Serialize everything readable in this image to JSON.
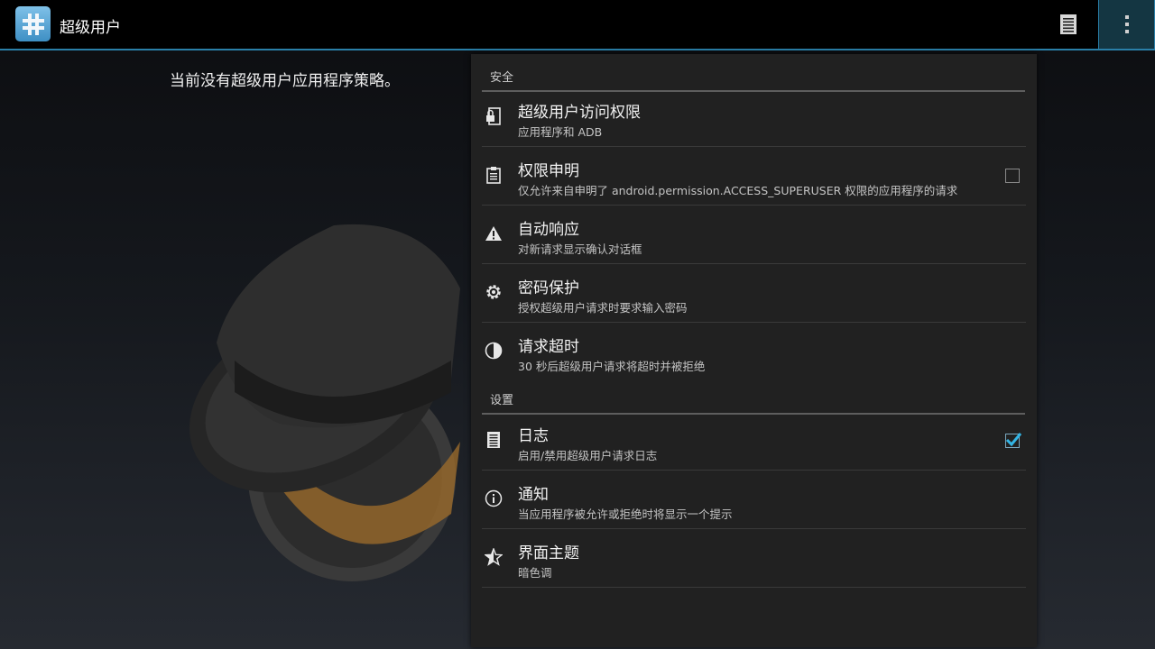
{
  "action_bar": {
    "title": "超级用户",
    "app_icon": "hash-app-icon",
    "log_icon": "log-list-icon",
    "overflow_icon": "overflow-menu-icon",
    "accent_color": "#2a7fa8"
  },
  "main": {
    "empty_message": "当前没有超级用户应用程序策略。"
  },
  "settings": {
    "security_header": "安全",
    "settings_header": "设置",
    "items": [
      {
        "title": "超级用户访问权限",
        "summary": "应用程序和 ADB",
        "icon": "lock-device-icon"
      },
      {
        "title": "权限申明",
        "summary": "仅允许来自申明了 android.permission.ACCESS_SUPERUSER 权限的应用程序的请求",
        "icon": "clipboard-icon",
        "checked": false
      },
      {
        "title": "自动响应",
        "summary": "对新请求显示确认对话框",
        "icon": "warning-icon"
      },
      {
        "title": "密码保护",
        "summary": "授权超级用户请求时要求输入密码",
        "icon": "gear-icon"
      },
      {
        "title": "请求超时",
        "summary": "30 秒后超级用户请求将超时并被拒绝",
        "icon": "timer-pie-icon"
      },
      {
        "title": "日志",
        "summary": "启用/禁用超级用户请求日志",
        "icon": "log-list-icon",
        "checked": true
      },
      {
        "title": "通知",
        "summary": "当应用程序被允许或拒绝时将显示一个提示",
        "icon": "info-icon"
      },
      {
        "title": "界面主题",
        "summary": "暗色调",
        "icon": "half-star-icon"
      }
    ]
  }
}
